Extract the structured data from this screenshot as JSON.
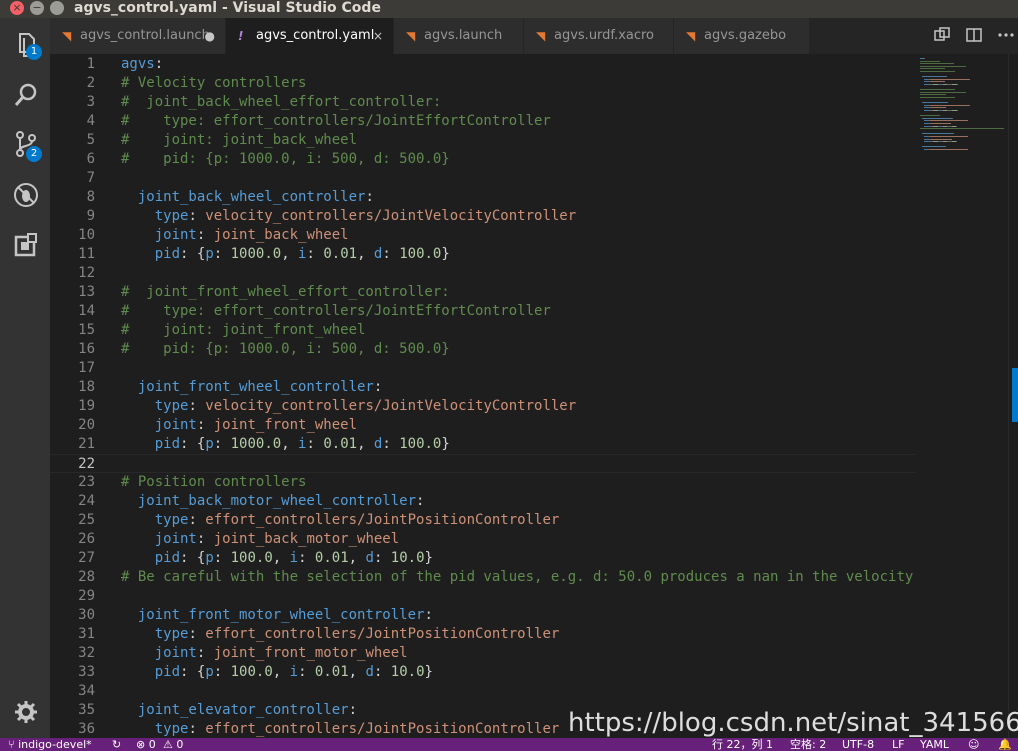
{
  "window": {
    "title": "agvs_control.yaml - Visual Studio Code",
    "close_glyph": "×",
    "minimize_glyph": "−"
  },
  "activity_bar": {
    "items": [
      {
        "name": "explorer-icon",
        "badge": "1"
      },
      {
        "name": "search-icon"
      },
      {
        "name": "source-control-icon",
        "badge": "2"
      },
      {
        "name": "debug-icon"
      },
      {
        "name": "extensions-icon"
      }
    ],
    "bottom": {
      "name": "gear-icon"
    }
  },
  "tabs": [
    {
      "label": "agvs_control.launch",
      "icon": "rss-icon",
      "modified": "●",
      "active": false
    },
    {
      "label": "agvs_control.yaml",
      "icon": "!",
      "close": "×",
      "active": true
    },
    {
      "label": "agvs.launch",
      "icon": "rss-icon",
      "active": false
    },
    {
      "label": "agvs.urdf.xacro",
      "icon": "rss-icon",
      "active": false
    },
    {
      "label": "agvs.gazebo",
      "icon": "rss-icon",
      "active": false
    }
  ],
  "editor": {
    "current_line": 22,
    "lines": [
      [
        [
          "k",
          "agvs"
        ],
        [
          "p",
          ":"
        ]
      ],
      [
        [
          "c",
          "# Velocity controllers"
        ]
      ],
      [
        [
          "c",
          "#  joint_back_wheel_effort_controller:"
        ]
      ],
      [
        [
          "c",
          "#    type: effort_controllers/JointEffortController"
        ]
      ],
      [
        [
          "c",
          "#    joint: joint_back_wheel"
        ]
      ],
      [
        [
          "c",
          "#    pid: {p: 1000.0, i: 500, d: 500.0}"
        ]
      ],
      [],
      [
        [
          "p",
          "  "
        ],
        [
          "k",
          "joint_back_wheel_controller"
        ],
        [
          "p",
          ":"
        ]
      ],
      [
        [
          "p",
          "    "
        ],
        [
          "k",
          "type"
        ],
        [
          "p",
          ": "
        ],
        [
          "s",
          "velocity_controllers/JointVelocityController"
        ]
      ],
      [
        [
          "p",
          "    "
        ],
        [
          "k",
          "joint"
        ],
        [
          "p",
          ": "
        ],
        [
          "s",
          "joint_back_wheel"
        ]
      ],
      [
        [
          "p",
          "    "
        ],
        [
          "k",
          "pid"
        ],
        [
          "p",
          ": {"
        ],
        [
          "k",
          "p"
        ],
        [
          "p",
          ": "
        ],
        [
          "n",
          "1000.0"
        ],
        [
          "p",
          ", "
        ],
        [
          "k",
          "i"
        ],
        [
          "p",
          ": "
        ],
        [
          "n",
          "0.01"
        ],
        [
          "p",
          ", "
        ],
        [
          "k",
          "d"
        ],
        [
          "p",
          ": "
        ],
        [
          "n",
          "100.0"
        ],
        [
          "p",
          "}"
        ]
      ],
      [],
      [
        [
          "c",
          "#  joint_front_wheel_effort_controller:"
        ]
      ],
      [
        [
          "c",
          "#    type: effort_controllers/JointEffortController"
        ]
      ],
      [
        [
          "c",
          "#    joint: joint_front_wheel"
        ]
      ],
      [
        [
          "c",
          "#    pid: {p: 1000.0, i: 500, d: 500.0}"
        ]
      ],
      [],
      [
        [
          "p",
          "  "
        ],
        [
          "k",
          "joint_front_wheel_controller"
        ],
        [
          "p",
          ":"
        ]
      ],
      [
        [
          "p",
          "    "
        ],
        [
          "k",
          "type"
        ],
        [
          "p",
          ": "
        ],
        [
          "s",
          "velocity_controllers/JointVelocityController"
        ]
      ],
      [
        [
          "p",
          "    "
        ],
        [
          "k",
          "joint"
        ],
        [
          "p",
          ": "
        ],
        [
          "s",
          "joint_front_wheel"
        ]
      ],
      [
        [
          "p",
          "    "
        ],
        [
          "k",
          "pid"
        ],
        [
          "p",
          ": {"
        ],
        [
          "k",
          "p"
        ],
        [
          "p",
          ": "
        ],
        [
          "n",
          "1000.0"
        ],
        [
          "p",
          ", "
        ],
        [
          "k",
          "i"
        ],
        [
          "p",
          ": "
        ],
        [
          "n",
          "0.01"
        ],
        [
          "p",
          ", "
        ],
        [
          "k",
          "d"
        ],
        [
          "p",
          ": "
        ],
        [
          "n",
          "100.0"
        ],
        [
          "p",
          "}"
        ]
      ],
      [],
      [
        [
          "c",
          "# Position controllers"
        ]
      ],
      [
        [
          "p",
          "  "
        ],
        [
          "k",
          "joint_back_motor_wheel_controller"
        ],
        [
          "p",
          ":"
        ]
      ],
      [
        [
          "p",
          "    "
        ],
        [
          "k",
          "type"
        ],
        [
          "p",
          ": "
        ],
        [
          "s",
          "effort_controllers/JointPositionController"
        ]
      ],
      [
        [
          "p",
          "    "
        ],
        [
          "k",
          "joint"
        ],
        [
          "p",
          ": "
        ],
        [
          "s",
          "joint_back_motor_wheel"
        ]
      ],
      [
        [
          "p",
          "    "
        ],
        [
          "k",
          "pid"
        ],
        [
          "p",
          ": {"
        ],
        [
          "k",
          "p"
        ],
        [
          "p",
          ": "
        ],
        [
          "n",
          "100.0"
        ],
        [
          "p",
          ", "
        ],
        [
          "k",
          "i"
        ],
        [
          "p",
          ": "
        ],
        [
          "n",
          "0.01"
        ],
        [
          "p",
          ", "
        ],
        [
          "k",
          "d"
        ],
        [
          "p",
          ": "
        ],
        [
          "n",
          "10.0"
        ],
        [
          "p",
          "}"
        ]
      ],
      [
        [
          "c",
          "# Be careful with the selection of the pid values, e.g. d: 50.0 produces a nan in the velocity"
        ]
      ],
      [],
      [
        [
          "p",
          "  "
        ],
        [
          "k",
          "joint_front_motor_wheel_controller"
        ],
        [
          "p",
          ":"
        ]
      ],
      [
        [
          "p",
          "    "
        ],
        [
          "k",
          "type"
        ],
        [
          "p",
          ": "
        ],
        [
          "s",
          "effort_controllers/JointPositionController"
        ]
      ],
      [
        [
          "p",
          "    "
        ],
        [
          "k",
          "joint"
        ],
        [
          "p",
          ": "
        ],
        [
          "s",
          "joint_front_motor_wheel"
        ]
      ],
      [
        [
          "p",
          "    "
        ],
        [
          "k",
          "pid"
        ],
        [
          "p",
          ": {"
        ],
        [
          "k",
          "p"
        ],
        [
          "p",
          ": "
        ],
        [
          "n",
          "100.0"
        ],
        [
          "p",
          ", "
        ],
        [
          "k",
          "i"
        ],
        [
          "p",
          ": "
        ],
        [
          "n",
          "0.01"
        ],
        [
          "p",
          ", "
        ],
        [
          "k",
          "d"
        ],
        [
          "p",
          ": "
        ],
        [
          "n",
          "10.0"
        ],
        [
          "p",
          "}"
        ]
      ],
      [],
      [
        [
          "p",
          "  "
        ],
        [
          "k",
          "joint_elevator_controller"
        ],
        [
          "p",
          ":"
        ]
      ],
      [
        [
          "p",
          "    "
        ],
        [
          "k",
          "type"
        ],
        [
          "p",
          ": "
        ],
        [
          "s",
          "effort_controllers/JointPositionController"
        ]
      ]
    ]
  },
  "watermark": "https://blog.csdn.net/sinat_34156619",
  "status_bar": {
    "branch": "indigo-devel*",
    "sync_glyph": "↻",
    "errors": "⊗ 0",
    "warnings": "⚠ 0",
    "position": "行 22，列 1",
    "indent": "空格: 2",
    "encoding": "UTF-8",
    "eol": "LF",
    "language": "YAML",
    "smiley": "☺",
    "bell": "🔔"
  },
  "colors": {
    "keyword": "#569cd6",
    "comment": "#608b4e",
    "string": "#ce9178",
    "number": "#b5cea8",
    "status_bar": "#68217a",
    "badge": "#007acc"
  }
}
